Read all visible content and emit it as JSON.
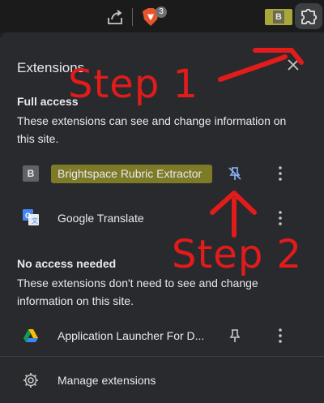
{
  "toolbar": {
    "share_icon": "share-icon",
    "brave_icon": "brave-shields-icon",
    "brave_count": "3",
    "pinned_extension_letter": "B",
    "extensions_icon": "puzzle-icon"
  },
  "panel": {
    "title": "Extensions",
    "close_icon": "close-icon",
    "full_access": {
      "heading": "Full access",
      "description": "These extensions can see and change information on this site.",
      "items": [
        {
          "name": "Brightspace Rubric Extractor",
          "icon_letter": "B",
          "pinned": true
        },
        {
          "name": "Google Translate",
          "pinned": false
        }
      ]
    },
    "no_access": {
      "heading": "No access needed",
      "description": "These extensions don't need to see and change information on this site.",
      "items": [
        {
          "name": "Application Launcher For D...",
          "pinned": false
        }
      ]
    },
    "manage_label": "Manage extensions"
  },
  "annotations": {
    "step1": "Step 1",
    "step2": "Step 2",
    "color": "#e21b1b",
    "highlight_color": "#8c8a28"
  }
}
